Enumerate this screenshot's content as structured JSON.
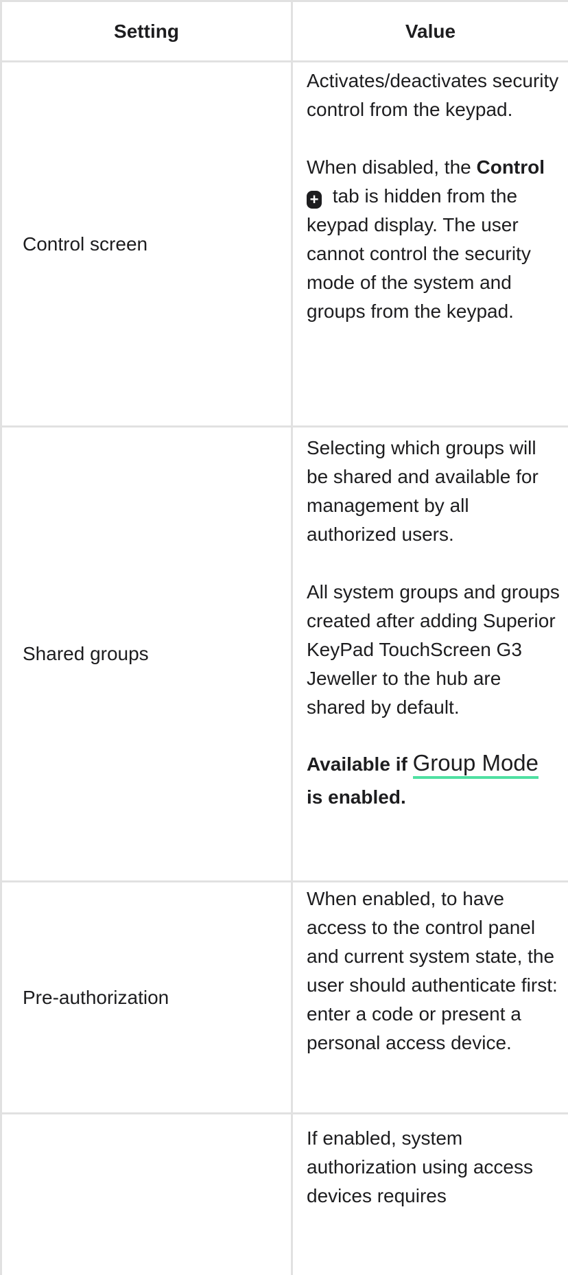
{
  "table": {
    "header": {
      "setting": "Setting",
      "value": "Value"
    },
    "rows": [
      {
        "setting": "Control screen",
        "p1": "Activates/deactivates security control from the keypad.",
        "p2_before": "When disabled, the ",
        "p2_bold": "Control",
        "p2_icon": "plus-icon",
        "p2_after": " tab is hidden from the keypad display. The user cannot control the security mode of the system and groups from the keypad."
      },
      {
        "setting": "Shared groups",
        "p1": "Selecting which groups will be shared and available for management by all authorized users.",
        "p2": "All system groups and groups created after adding Superior KeyPad TouchScreen G3 Jeweller to the hub are shared by default.",
        "note_before": "Available if ",
        "note_link": "Group Mode",
        "note_after": " is enabled."
      },
      {
        "setting": "Pre-authorization",
        "p1": "When enabled, to have access to the control panel and current system state, the user should authenticate first: enter a code or present a personal access device."
      },
      {
        "setting": "",
        "p1": "If enabled, system authorization using access devices requires"
      }
    ]
  },
  "colors": {
    "border": "#e1e1e1",
    "link_underline": "#4fe0a2",
    "text": "#1d1d1f"
  }
}
